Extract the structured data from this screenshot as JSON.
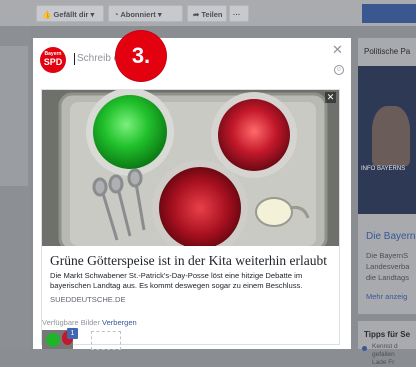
{
  "background": {
    "page_buttons": [
      {
        "label": "Gefällt dir ▾",
        "icon": "thumbs-up-icon"
      },
      {
        "label": "Abonniert ▾",
        "icon": "rss-icon"
      },
      {
        "label": "Teilen",
        "icon": "share-arrow-icon"
      },
      {
        "label": "···"
      }
    ],
    "right_column": {
      "heading": "Politische Pa",
      "image_caption": "INFO BAYERNS",
      "post_title": "Die Bayern",
      "post_text": [
        "Die BayernS",
        "Landesverba",
        "die Landtags"
      ],
      "more_link": "Mehr anzeig",
      "tips_heading": "Tipps für Se",
      "tip_text": [
        "Kennst d",
        "gefallen",
        "Lade Fr"
      ]
    }
  },
  "composer": {
    "logo": {
      "line1": "Bayern",
      "line2": "SPD"
    },
    "placeholder": "Schreib et",
    "step_marker": "3.",
    "close_icon": "close-icon",
    "emoji_icon": "smiley-icon"
  },
  "link_preview": {
    "headline": "Grüne Götterspeise ist in der Kita weiterhin erlaubt",
    "description": "Die Markt Schwabener St.-Patrick's-Day-Posse löst eine hitzige Debatte im bayerischen Landtag aus. Es kommt deswegen sogar zu einem Beschluss.",
    "domain": "SUEDDEUTSCHE.DE",
    "colors": {
      "jelly_green": "#1fb52a",
      "jelly_red": "#c3182a",
      "tray": "#b7b8b2"
    }
  },
  "images": {
    "label": "Verfügbare Bilder",
    "hide_link": "Verbergen",
    "badge": "1"
  }
}
